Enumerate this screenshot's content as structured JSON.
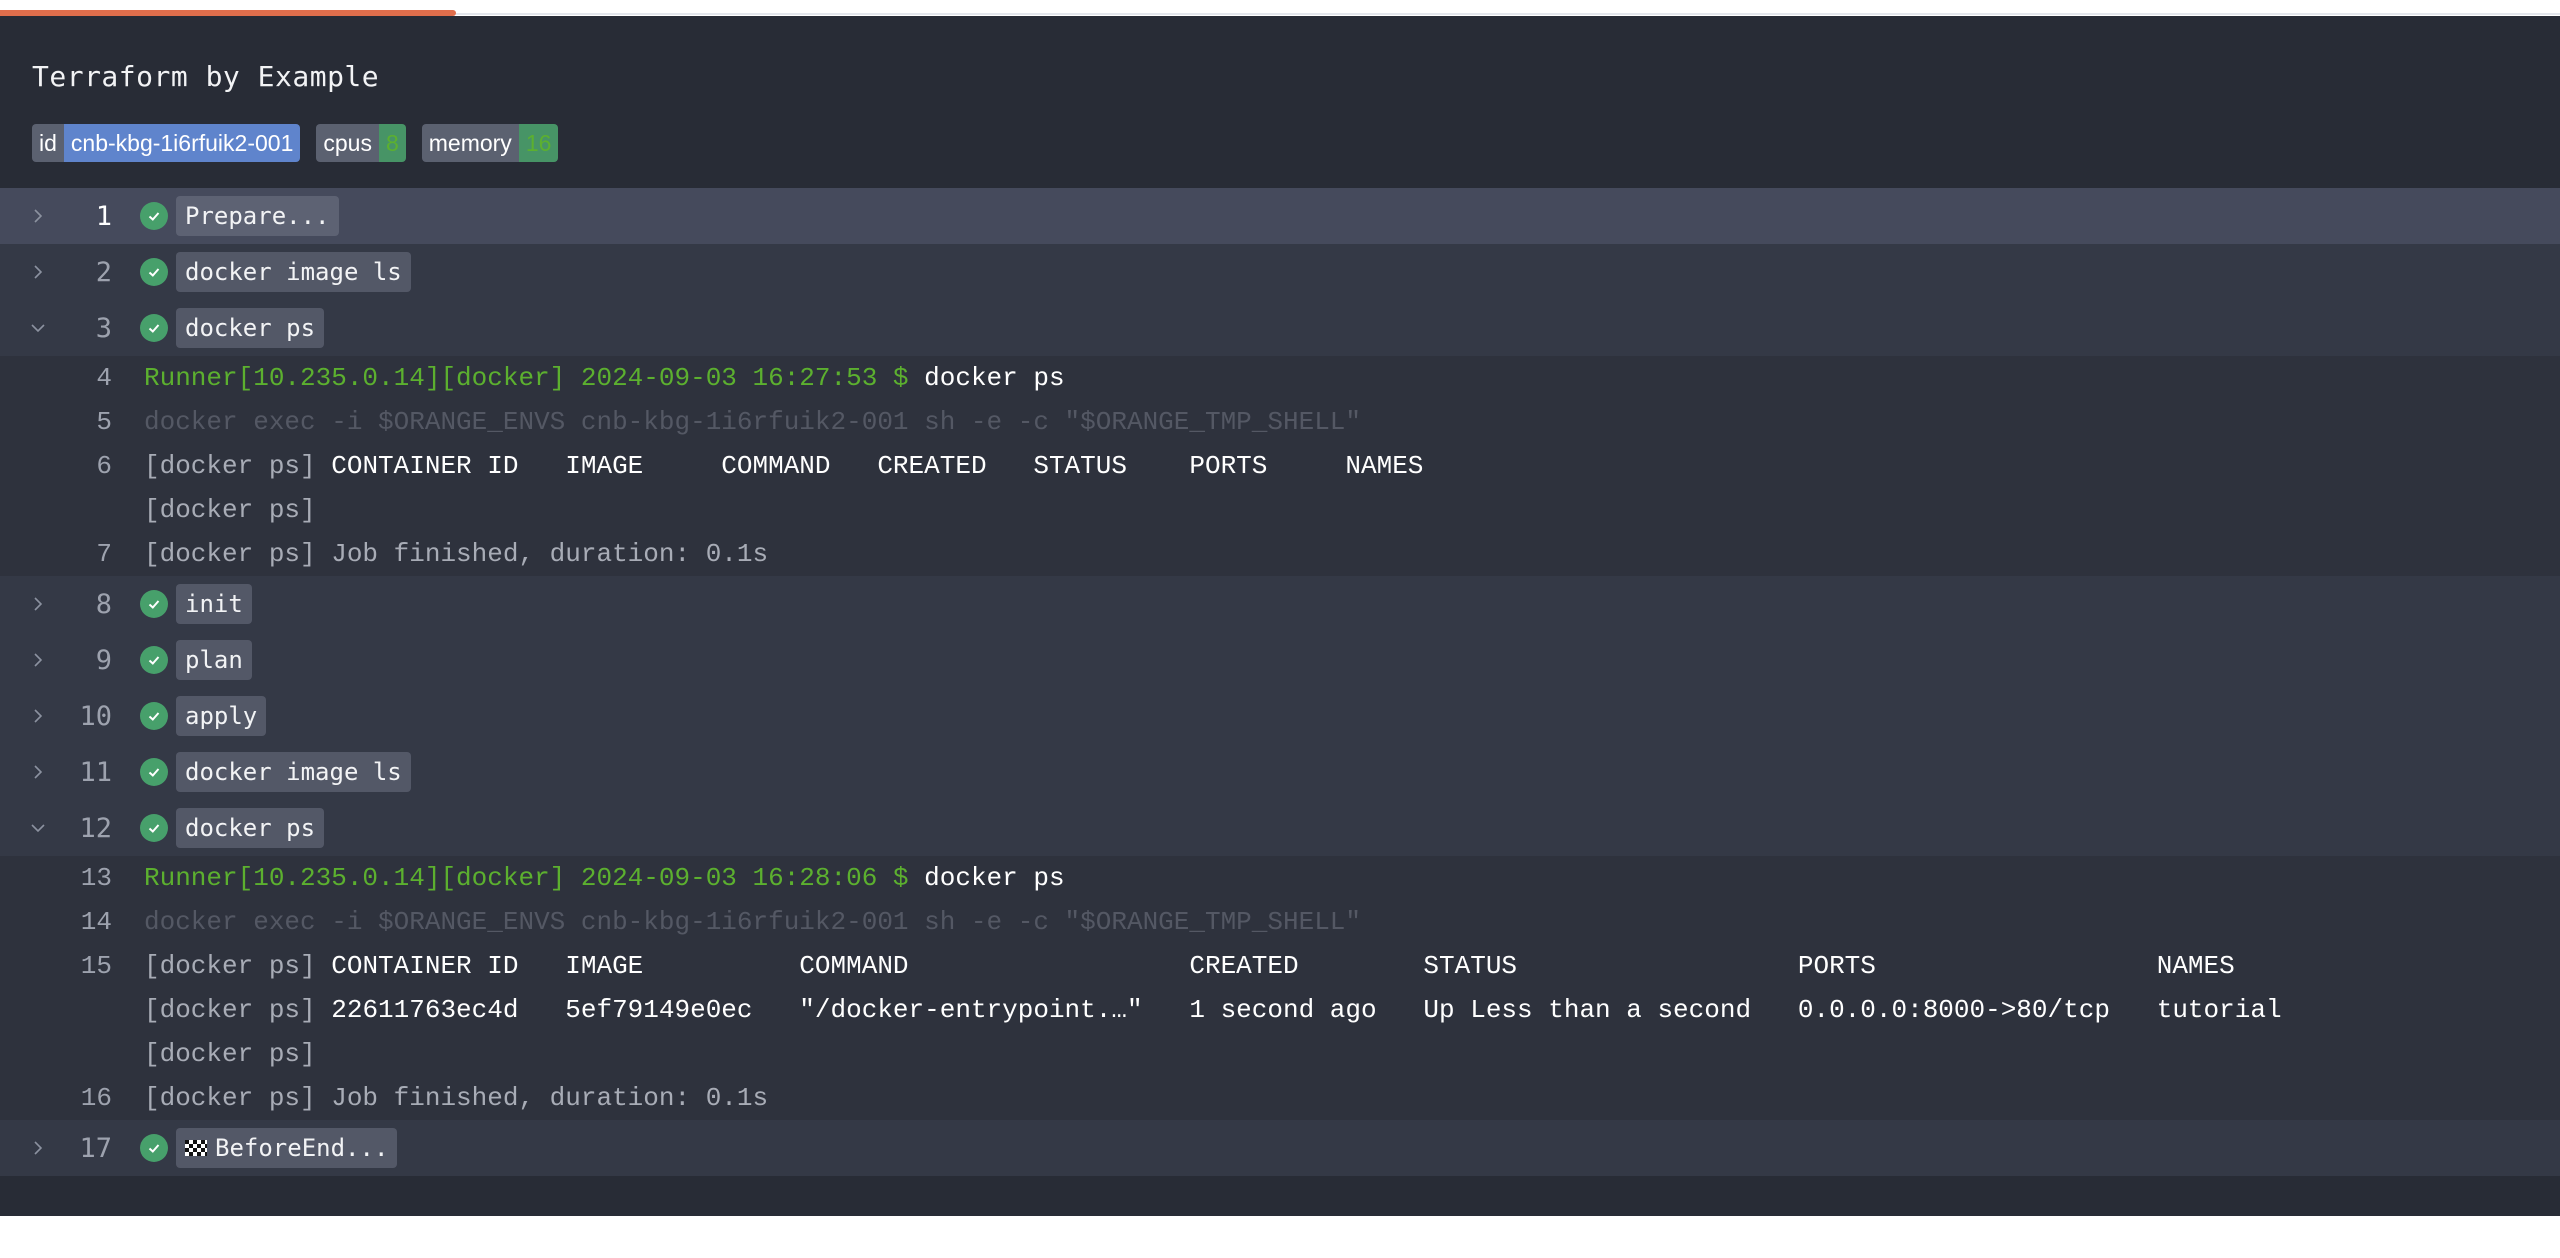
{
  "progress": {
    "value_percent": 17.8,
    "color": "#e06e4c"
  },
  "title": "Terraform by Example",
  "tags": [
    {
      "key": "id",
      "value": "cnb-kbg-1i6rfuik2-001",
      "color": "#5f84cc"
    },
    {
      "key": "cpus",
      "value": "8",
      "color": "#479466"
    },
    {
      "key": "memory",
      "value": "16",
      "color": "#479466"
    }
  ],
  "steps": {
    "s1": {
      "num": "1",
      "label": "Prepare...",
      "expanded": false,
      "status": "success"
    },
    "s2": {
      "num": "2",
      "label": "docker image ls",
      "expanded": false,
      "status": "success"
    },
    "s3": {
      "num": "3",
      "label": "docker ps",
      "expanded": true,
      "status": "success"
    },
    "s8": {
      "num": "8",
      "label": "init",
      "expanded": false,
      "status": "success"
    },
    "s9": {
      "num": "9",
      "label": "plan",
      "expanded": false,
      "status": "success"
    },
    "s10": {
      "num": "10",
      "label": "apply",
      "expanded": false,
      "status": "success"
    },
    "s11": {
      "num": "11",
      "label": "docker image ls",
      "expanded": false,
      "status": "success"
    },
    "s12": {
      "num": "12",
      "label": "docker ps",
      "expanded": true,
      "status": "success"
    },
    "s17": {
      "num": "17",
      "label": "BeforeEnd...",
      "icon": "checkered-flag",
      "expanded": false,
      "status": "success"
    }
  },
  "log3": {
    "l4": {
      "num": "4",
      "prefix": "Runner[10.235.0.14][docker] 2024-09-03 16:27:53 $ ",
      "cmd": "docker ps"
    },
    "l5": {
      "num": "5",
      "text": "docker exec -i $ORANGE_ENVS cnb-kbg-1i6rfuik2-001 sh -e -c \"$ORANGE_TMP_SHELL\""
    },
    "l6": {
      "num": "6",
      "prefix": "[docker ps] ",
      "text": "CONTAINER ID   IMAGE     COMMAND   CREATED   STATUS    PORTS     NAMES"
    },
    "l6b": {
      "num": "",
      "prefix": "[docker ps]",
      "text": ""
    },
    "l7": {
      "num": "7",
      "text": "[docker ps] Job finished, duration: 0.1s"
    }
  },
  "log12": {
    "l13": {
      "num": "13",
      "prefix": "Runner[10.235.0.14][docker] 2024-09-03 16:28:06 $ ",
      "cmd": "docker ps"
    },
    "l14": {
      "num": "14",
      "text": "docker exec -i $ORANGE_ENVS cnb-kbg-1i6rfuik2-001 sh -e -c \"$ORANGE_TMP_SHELL\""
    },
    "l15": {
      "num": "15",
      "prefix": "[docker ps] ",
      "text": "CONTAINER ID   IMAGE          COMMAND                  CREATED        STATUS                  PORTS                  NAMES"
    },
    "l15b": {
      "num": "",
      "prefix": "[docker ps] ",
      "text": "22611763ec4d   5ef79149e0ec   \"/docker-entrypoint.…\"   1 second ago   Up Less than a second   0.0.0.0:8000->80/tcp   tutorial"
    },
    "l15c": {
      "num": "",
      "prefix": "[docker ps]",
      "text": ""
    },
    "l16": {
      "num": "16",
      "text": "[docker ps] Job finished, duration: 0.1s"
    }
  }
}
